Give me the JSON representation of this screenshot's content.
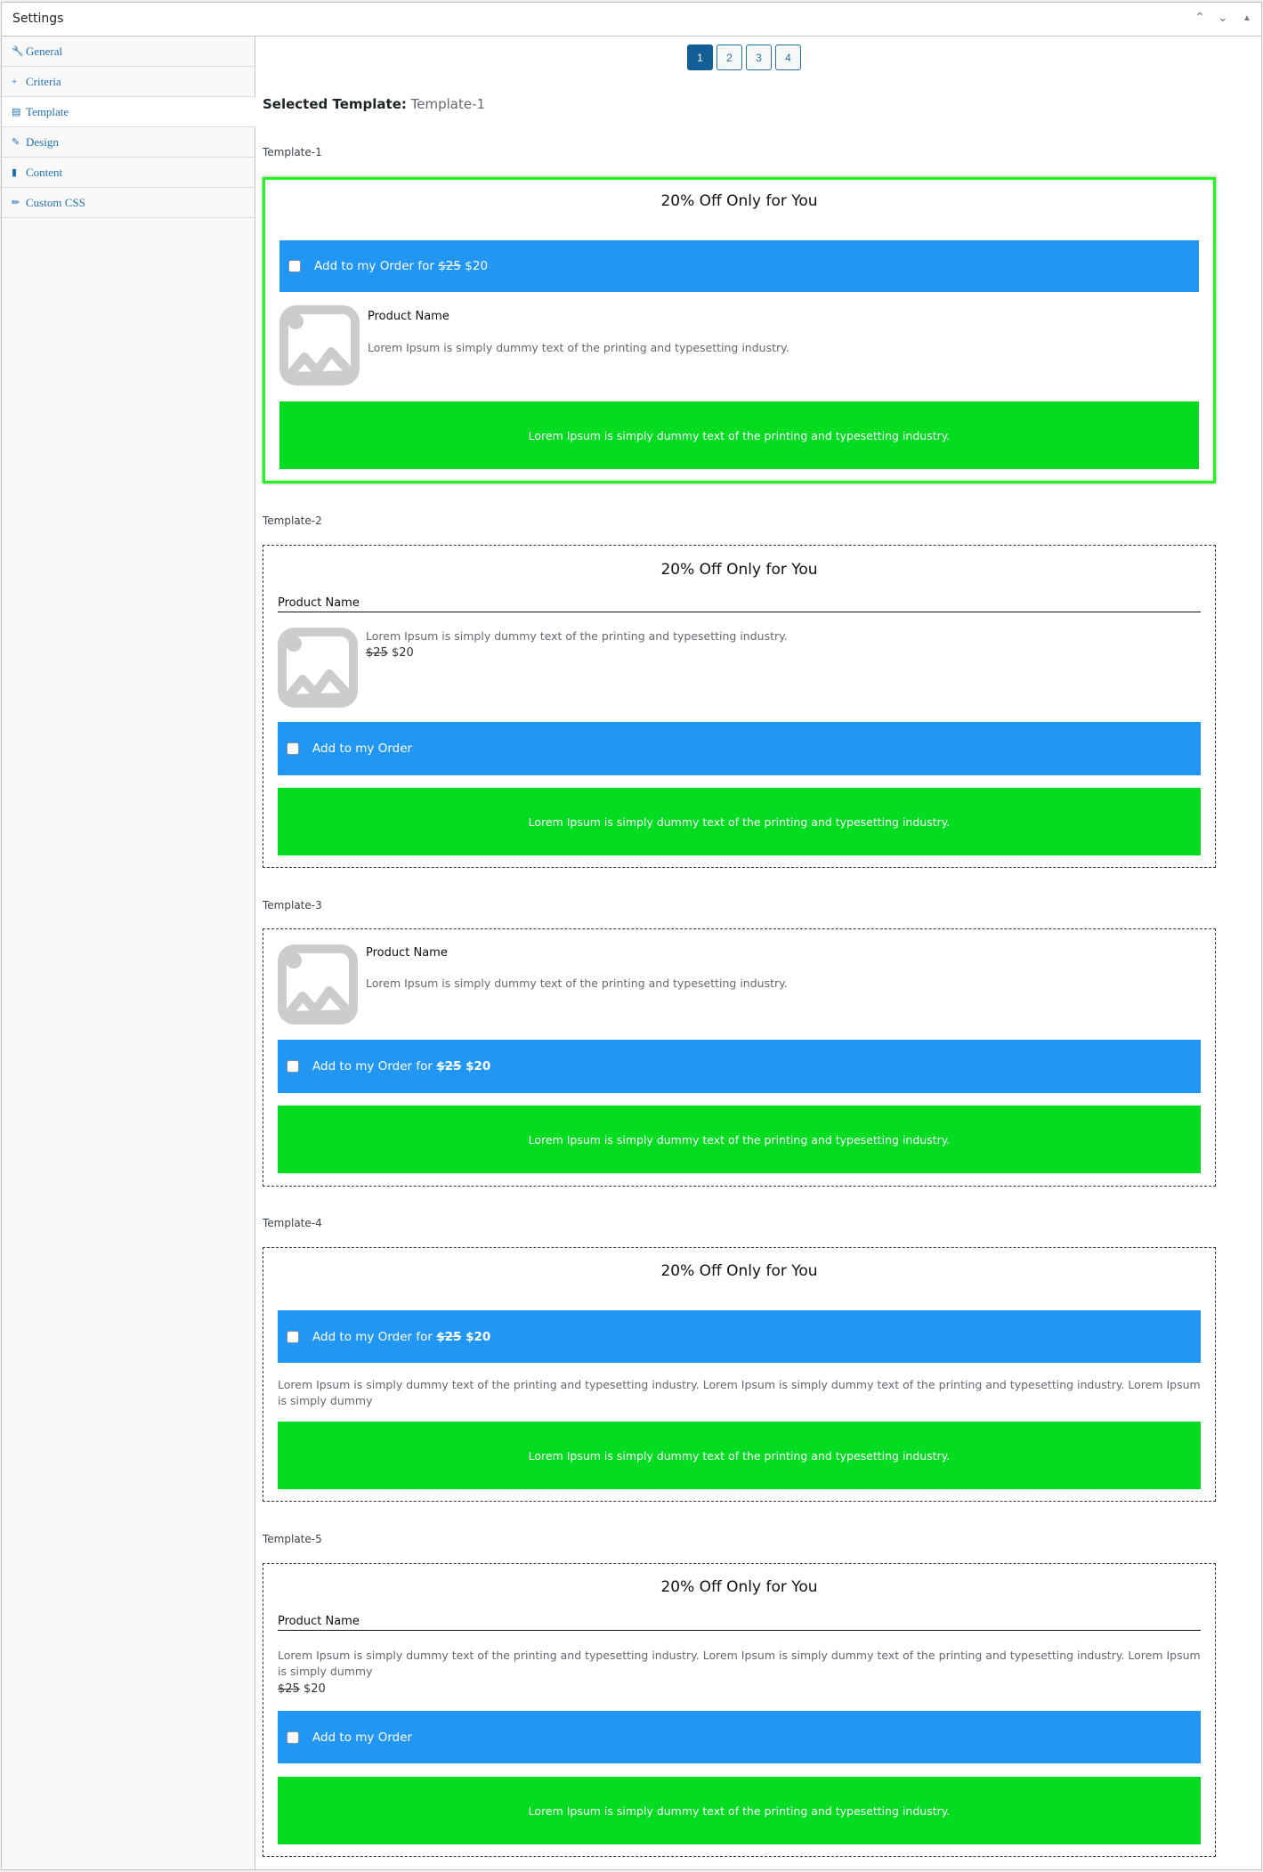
{
  "header": {
    "title": "Settings",
    "move_up": "⌃",
    "move_down": "⌄",
    "collapse": "▲"
  },
  "sidebar": {
    "items": [
      {
        "icon": "🔧",
        "label": "General"
      },
      {
        "icon": "+",
        "label": "Criteria"
      },
      {
        "icon": "▤",
        "label": "Template"
      },
      {
        "icon": "✎",
        "label": "Design"
      },
      {
        "icon": "▮",
        "label": "Content"
      },
      {
        "icon": "✏",
        "label": "Custom CSS"
      }
    ]
  },
  "pagination": [
    "1",
    "2",
    "3",
    "4"
  ],
  "selected": {
    "label": "Selected Template:",
    "value": "Template-1"
  },
  "common": {
    "title": "20% Off Only for You",
    "product_name": "Product Name",
    "desc": "Lorem Ipsum is simply dummy text of the printing and typesetting industry.",
    "long_desc": "Lorem Ipsum is simply dummy text of the printing and typesetting industry. Lorem Ipsum is simply dummy text of the printing and typesetting industry. Lorem Ipsum is simply dummy",
    "green_text": "Lorem Ipsum is simply dummy text of the printing and typesetting industry.",
    "add_for": "Add to my Order for",
    "add": "Add to my Order",
    "old_price": "$25",
    "new_price": "$20"
  },
  "templates": [
    "Template-1",
    "Template-2",
    "Template-3",
    "Template-4",
    "Template-5"
  ],
  "colors": {
    "blue": "#2196f3",
    "green": "#04dc22",
    "selected_border": "#1bfb18"
  }
}
